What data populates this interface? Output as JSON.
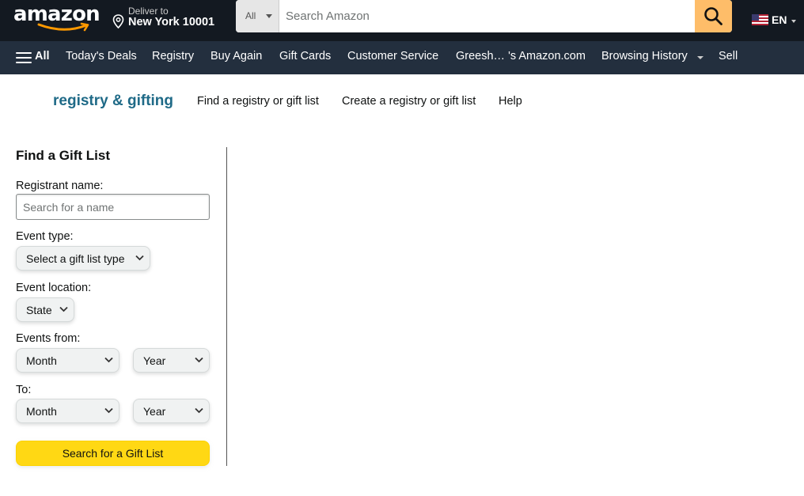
{
  "header": {
    "logo_text": "amazon",
    "deliver_line1": "Deliver to",
    "deliver_line2": "New York 10001",
    "search_category": "All",
    "search_placeholder": "Search Amazon",
    "language": "EN"
  },
  "subnav": {
    "all_label": "All",
    "items": [
      "Today's Deals",
      "Registry",
      "Buy Again",
      "Gift Cards",
      "Customer Service",
      "Greesh… 's Amazon.com",
      "Browsing History",
      "Sell"
    ]
  },
  "registry": {
    "brand": "registry & gifting",
    "links": [
      "Find a registry or gift list",
      "Create a registry or gift list",
      "Help"
    ]
  },
  "form": {
    "title": "Find a Gift List",
    "registrant_label": "Registrant name:",
    "registrant_placeholder": "Search for a name",
    "event_type_label": "Event type:",
    "event_type_value": "Select a gift list type",
    "event_location_label": "Event location:",
    "event_location_value": "State",
    "events_from_label": "Events from:",
    "from_month": "Month",
    "from_year": "Year",
    "to_label": "To:",
    "to_month": "Month",
    "to_year": "Year",
    "submit_label": "Search for a Gift List"
  },
  "colors": {
    "nav_bg": "#131921",
    "subnav_bg": "#232f3e",
    "search_button": "#febd69",
    "brand_text": "#1f6a87",
    "primary_button": "#ffd814"
  }
}
